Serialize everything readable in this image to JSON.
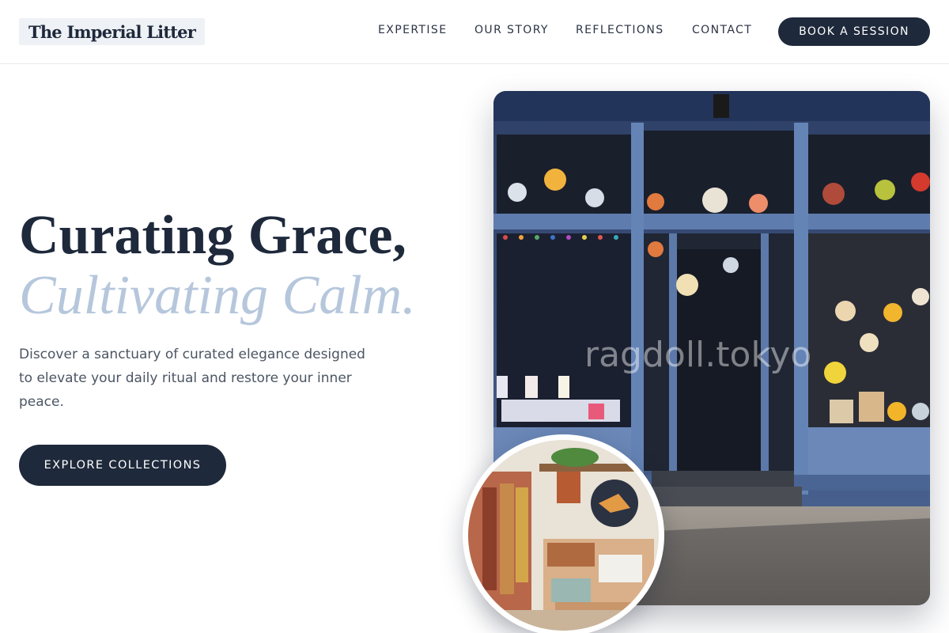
{
  "header": {
    "logo": "The Imperial Litter",
    "nav": [
      {
        "label": "EXPERTISE"
      },
      {
        "label": "OUR STORY"
      },
      {
        "label": "REFLECTIONS"
      },
      {
        "label": "CONTACT"
      }
    ],
    "cta_label": "BOOK A SESSION"
  },
  "hero": {
    "headline_line1": "Curating Grace,",
    "headline_line2": "Cultivating Calm.",
    "description": "Discover a sanctuary of curated elegance designed to elevate your daily ritual and restore your inner peace.",
    "cta_label": "EXPLORE COLLECTIONS"
  },
  "images": {
    "main_watermark": "ragdoll.tokyo"
  },
  "colors": {
    "navy": "#1e293b",
    "accent_light_blue": "#b6c7dc",
    "storefront_blue": "#5b7aa8"
  }
}
